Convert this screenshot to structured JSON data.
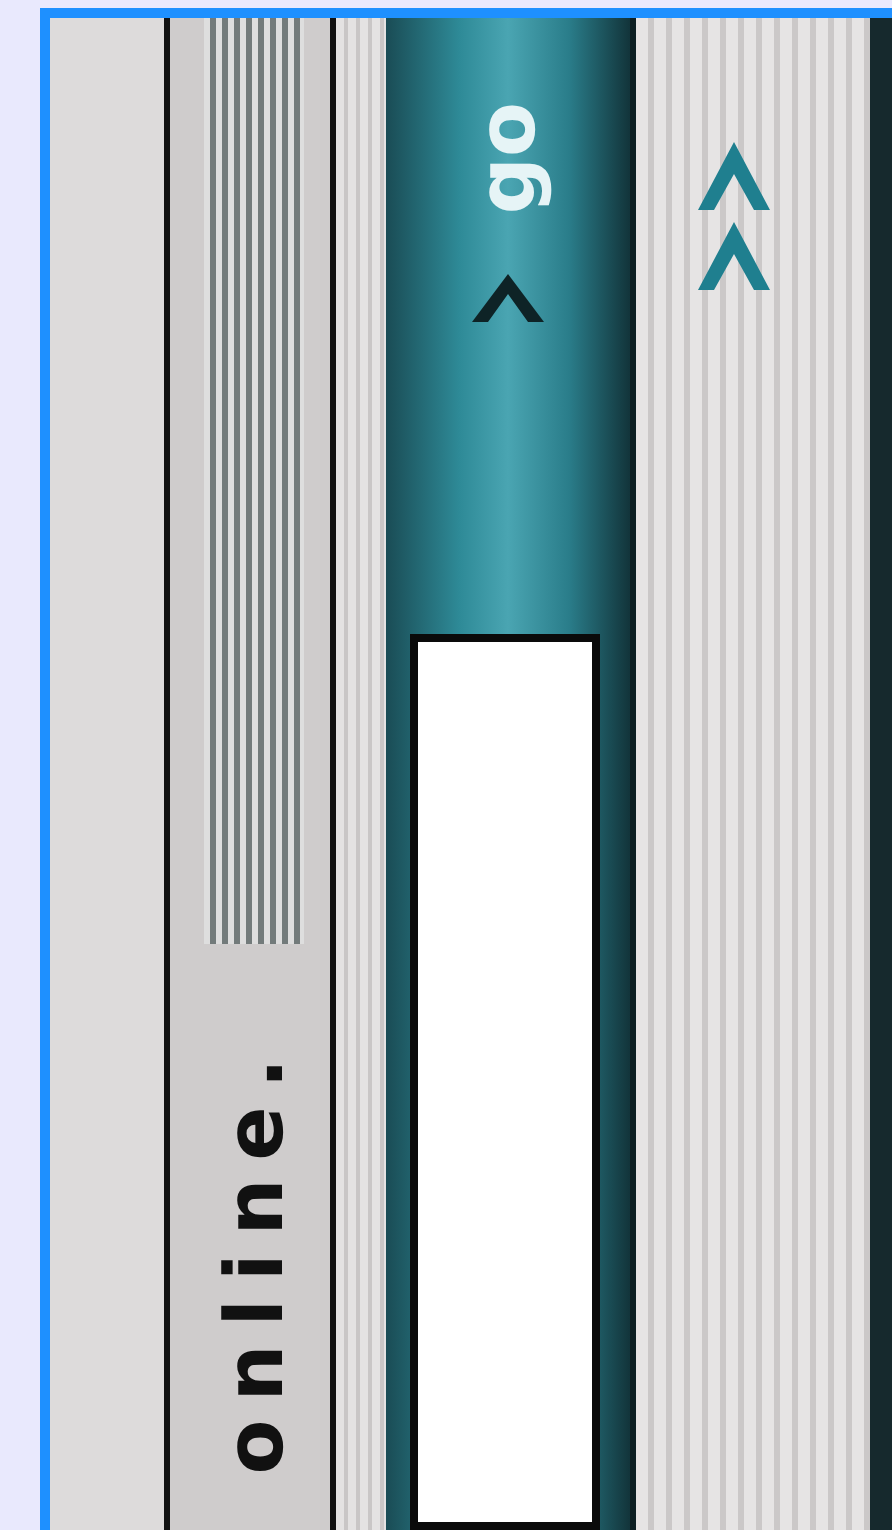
{
  "status": {
    "text": "online."
  },
  "search": {
    "button": "go"
  }
}
